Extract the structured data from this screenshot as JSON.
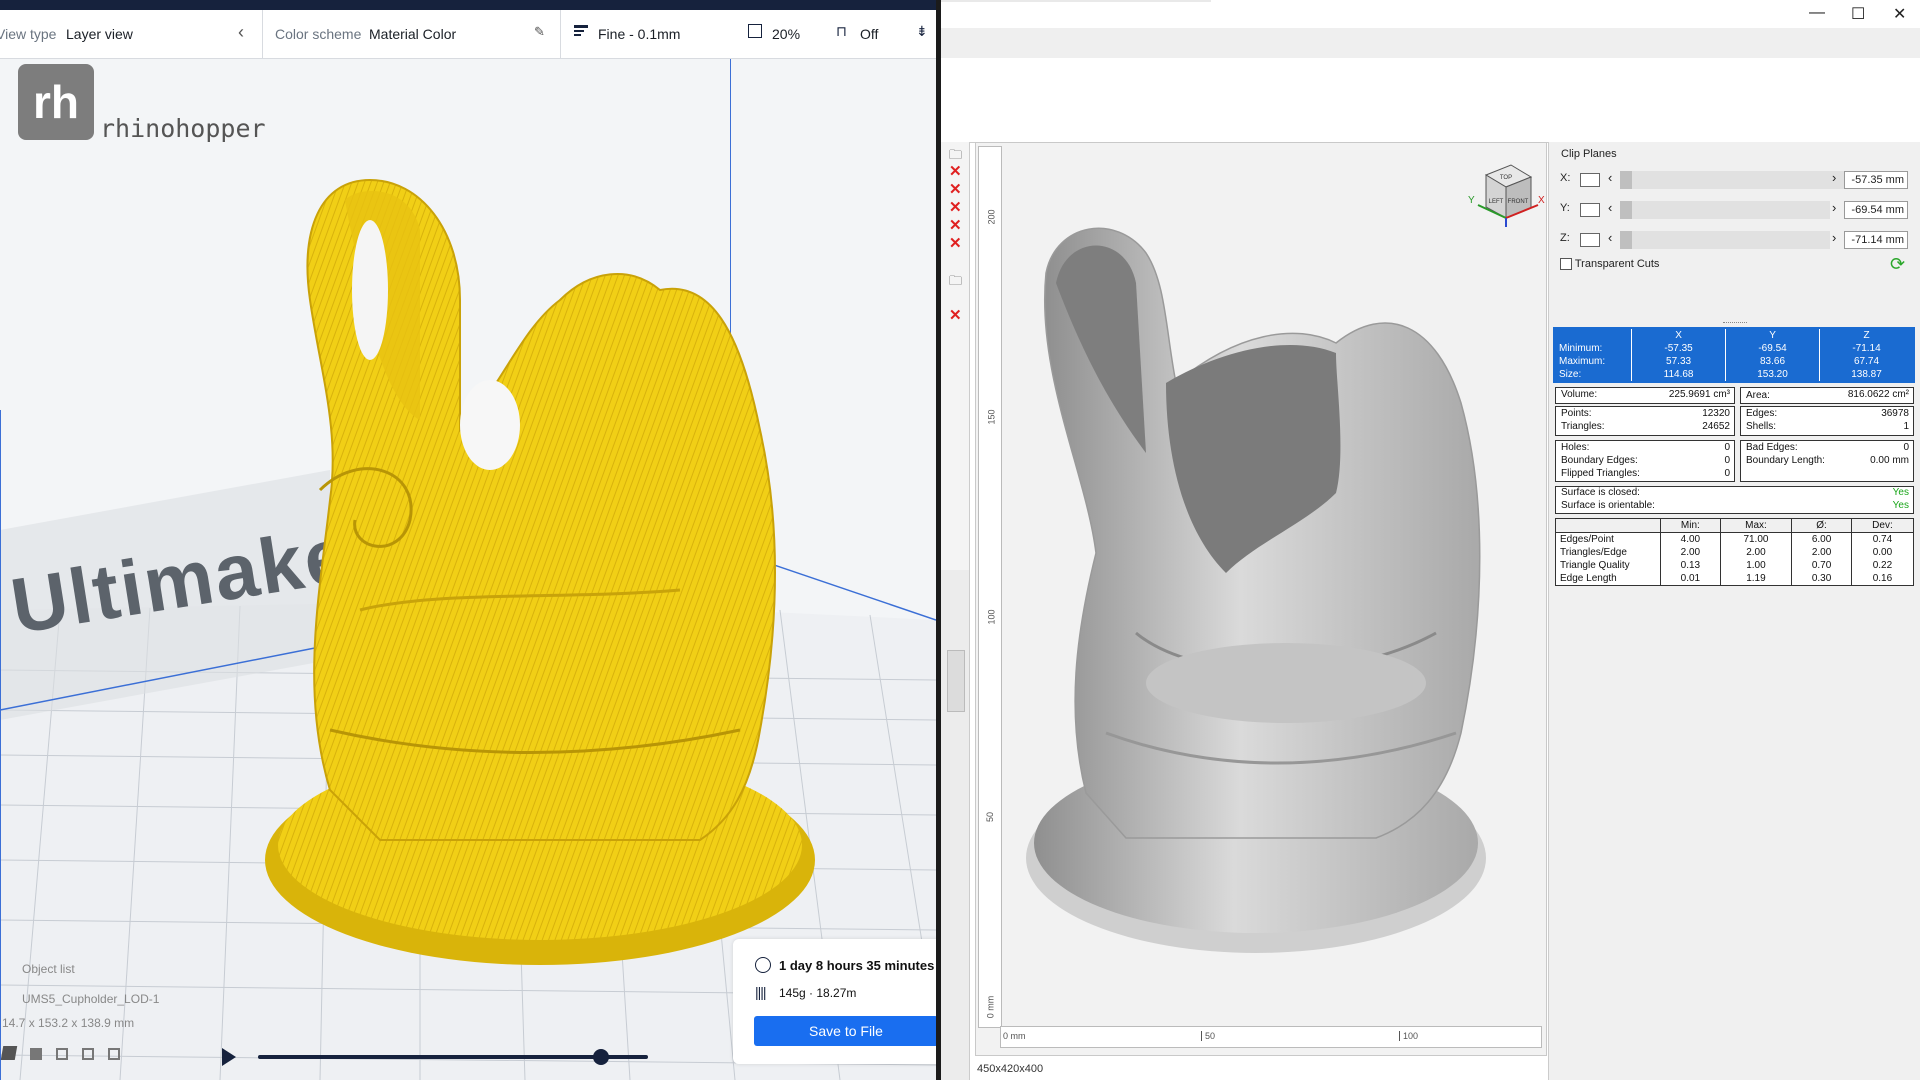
{
  "cura": {
    "toolbar": {
      "view_type_label": "View type",
      "view_type_value": "Layer view",
      "color_scheme_label": "Color scheme",
      "color_scheme_value": "Material Color",
      "profile": "Fine - 0.1mm",
      "infill": "20%",
      "support": "Off"
    },
    "logo": {
      "mark": "rh",
      "name": "rhinohopper"
    },
    "bed_text": "Ultimake",
    "object_list": {
      "header": "Object list",
      "item": "UMS5_Cupholder_LOD-1",
      "dimensions": "14.7 x 153.2 x 138.9 mm"
    },
    "estimate": {
      "time": "1 day 8 hours 35 minutes",
      "material": "145g · 18.27m",
      "save_label": "Save to File"
    },
    "layer_progress": 0.88
  },
  "netfabb": {
    "clip_planes": {
      "title": "Clip Planes",
      "rows": [
        {
          "axis": "X:",
          "value": "-57.35 mm"
        },
        {
          "axis": "Y:",
          "value": "-69.54 mm"
        },
        {
          "axis": "Z:",
          "value": "-71.14 mm"
        }
      ],
      "transparent_cuts": "Transparent Cuts"
    },
    "nav_cube": {
      "top": "TOP",
      "left": "LEFT",
      "front": "FRONT",
      "axis_y": "Y",
      "axis_x": "X"
    },
    "vruler": [
      "200",
      "150",
      "100",
      "50",
      "0 mm"
    ],
    "hruler": [
      "0 mm",
      "50",
      "100"
    ],
    "status": "450x420x400",
    "bbox": {
      "headers": [
        "X",
        "Y",
        "Z"
      ],
      "rows": [
        {
          "label": "Minimum:",
          "values": [
            "-57.35",
            "-69.54",
            "-71.14"
          ]
        },
        {
          "label": "Maximum:",
          "values": [
            "57.33",
            "83.66",
            "67.74"
          ]
        },
        {
          "label": "Size:",
          "values": [
            "114.68",
            "153.20",
            "138.87"
          ]
        }
      ]
    },
    "volume": {
      "label": "Volume:",
      "value": "225.9691 cm³",
      "area_label": "Area:",
      "area_value": "816.0622 cm²"
    },
    "counts": {
      "points_label": "Points:",
      "points": "12320",
      "triangles_label": "Triangles:",
      "triangles": "24652",
      "edges_label": "Edges:",
      "edges": "36978",
      "shells_label": "Shells:",
      "shells": "1"
    },
    "defects": {
      "holes_label": "Holes:",
      "holes": "0",
      "boundary_edges_label": "Boundary Edges:",
      "boundary_edges": "0",
      "flipped_label": "Flipped Triangles:",
      "flipped": "0",
      "bad_edges_label": "Bad Edges:",
      "bad_edges": "0",
      "boundary_length_label": "Boundary Length:",
      "boundary_length": "0.00 mm"
    },
    "surface": {
      "closed_label": "Surface is closed:",
      "closed": "Yes",
      "orientable_label": "Surface is orientable:",
      "orientable": "Yes"
    },
    "quality": {
      "headers": [
        "Min:",
        "Max:",
        "Ø:",
        "Dev:"
      ],
      "rows": [
        {
          "label": "Edges/Point",
          "values": [
            "4.00",
            "71.00",
            "6.00",
            "0.74"
          ]
        },
        {
          "label": "Triangles/Edge",
          "values": [
            "2.00",
            "2.00",
            "2.00",
            "0.00"
          ]
        },
        {
          "label": "Triangle Quality",
          "values": [
            "0.13",
            "1.00",
            "0.70",
            "0.22"
          ]
        },
        {
          "label": "Edge Length",
          "values": [
            "0.01",
            "1.19",
            "0.30",
            "0.16"
          ]
        }
      ]
    }
  }
}
